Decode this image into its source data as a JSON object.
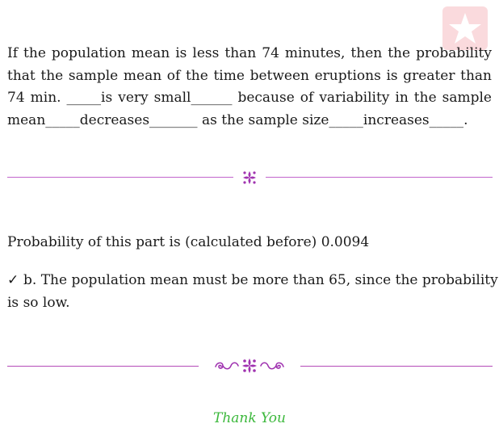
{
  "question": {
    "lines": [
      "If the population mean is less than 74 minutes, then the probability",
      "that the sample mean of the time between eruptions is greater than",
      "74 min.  _____is very small______ because of variability in the sample",
      "mean_____decreases_______ as the sample size_____increases_____."
    ]
  },
  "answer": {
    "probability_text": "Probability of this part is (calculated before) 0.0094",
    "choice_mark": "✓",
    "choice_lines": [
      "b.  The population mean must be more than 65, since the probability",
      "is so low."
    ]
  },
  "closing": {
    "thanks": "Thank You"
  },
  "colors": {
    "divider": "#c266cc",
    "ornament": "#a033b0",
    "thanks": "#3cb83c"
  },
  "icons": {
    "logo": "star-logo-icon",
    "ornament_small": "floral-ornament-icon",
    "ornament_large": "flourish-ornament-icon"
  }
}
